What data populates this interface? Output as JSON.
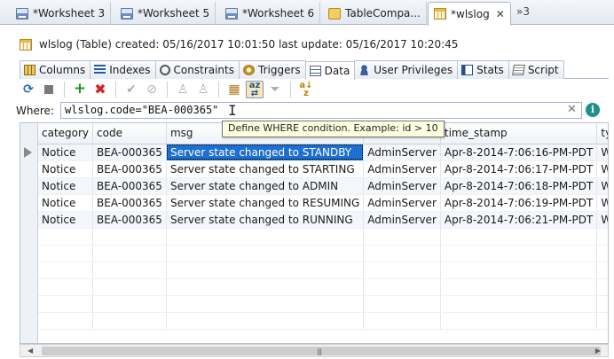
{
  "editor_tabs": [
    {
      "label": "*Worksheet 3",
      "icon": "sql-worksheet-icon"
    },
    {
      "label": "*Worksheet 5",
      "icon": "sql-worksheet-icon"
    },
    {
      "label": "*Worksheet 6",
      "icon": "sql-worksheet-icon"
    },
    {
      "label": "TableCompa...",
      "icon": "table-compare-icon"
    },
    {
      "label": "*wlslog",
      "icon": "table-icon",
      "active": true
    }
  ],
  "tab_overflow": "»3",
  "header": {
    "text": "wlslog (Table) created: 05/16/2017 10:01:50 last update: 05/16/2017 10:20:45"
  },
  "property_tabs": [
    {
      "label": "Columns",
      "icon": "columns-icon"
    },
    {
      "label": "Indexes",
      "icon": "indexes-icon"
    },
    {
      "label": "Constraints",
      "icon": "constraints-icon"
    },
    {
      "label": "Triggers",
      "icon": "triggers-icon"
    },
    {
      "label": "Data",
      "icon": "data-icon",
      "active": true
    },
    {
      "label": "User Privileges",
      "icon": "user-privileges-icon"
    },
    {
      "label": "Stats",
      "icon": "stats-icon"
    },
    {
      "label": "Script",
      "icon": "script-icon"
    }
  ],
  "toolbar": {
    "buttons": [
      "refresh-icon",
      "stop-icon",
      "add-row-icon",
      "delete-row-icon",
      "commit-icon",
      "cancel-icon",
      "import-icon",
      "export-icon",
      "column-filter-icon",
      "sort-icon",
      "filter-icon",
      "order-by-icon"
    ],
    "pressed": "sort-icon"
  },
  "where": {
    "label": "Where:",
    "value": "wlslog.code=\"BEA-000365\"",
    "tooltip": "Define WHERE condition. Example: id > 10",
    "info_glyph": "i",
    "clear_glyph": "✕"
  },
  "grid": {
    "columns": [
      "category",
      "code",
      "msg",
      "",
      "time_stamp",
      "type"
    ],
    "rows": [
      [
        "Notice",
        "BEA-000365",
        "Server state changed to STANDBY",
        "AdminServer",
        "Apr-8-2014-7:06:16-PM-PDT",
        "WebLogi"
      ],
      [
        "Notice",
        "BEA-000365",
        "Server state changed to STARTING",
        "AdminServer",
        "Apr-8-2014-7:06:17-PM-PDT",
        "WebLogi"
      ],
      [
        "Notice",
        "BEA-000365",
        "Server state changed to ADMIN",
        "AdminServer",
        "Apr-8-2014-7:06:18-PM-PDT",
        "WebLogi"
      ],
      [
        "Notice",
        "BEA-000365",
        "Server state changed to RESUMING",
        "AdminServer",
        "Apr-8-2014-7:06:19-PM-PDT",
        "WebLogi"
      ],
      [
        "Notice",
        "BEA-000365",
        "Server state changed to RUNNING",
        "AdminServer",
        "Apr-8-2014-7:06:21-PM-PDT",
        "WebLogi"
      ]
    ],
    "selected": {
      "row": 0,
      "column": 2
    }
  },
  "colors": {
    "selection": "#1d6fd1",
    "tooltip_bg": "#ffffe1",
    "info": "#1e8f8a",
    "add": "#1a9a1a",
    "delete": "#d42020"
  }
}
